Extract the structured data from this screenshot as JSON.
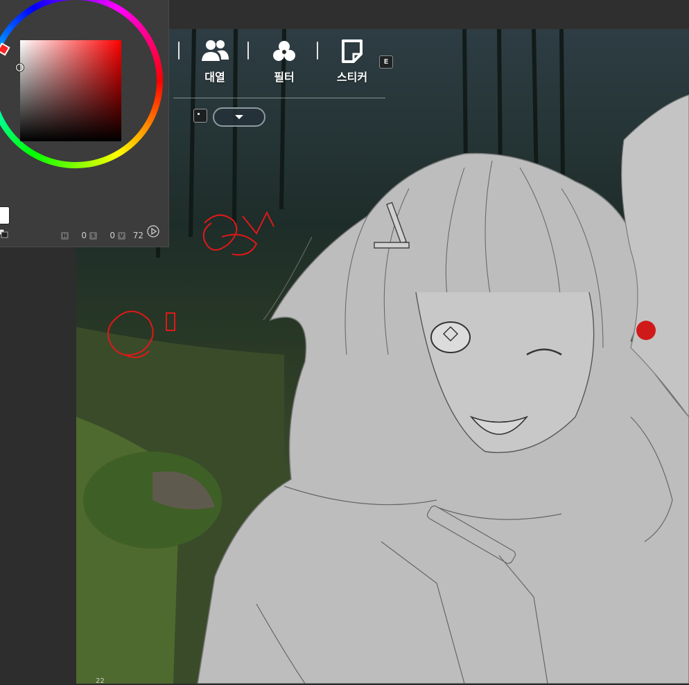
{
  "menu": {
    "items": [
      {
        "label": "대열",
        "icon": "party-icon"
      },
      {
        "label": "필터",
        "icon": "filter-icon"
      },
      {
        "label": "스티커",
        "icon": "sticker-icon"
      }
    ],
    "hotkey": "E",
    "dropdown_icon": "chevron-down-icon"
  },
  "color_panel": {
    "hue_label": "H",
    "hue_value": "0",
    "saturation_label": "S",
    "saturation_value": "0",
    "value_label": "V",
    "value_value": "72",
    "colors": {
      "primary": "#ff0000",
      "foreground": "#ffffff"
    }
  },
  "status": {
    "zoom": "22"
  }
}
